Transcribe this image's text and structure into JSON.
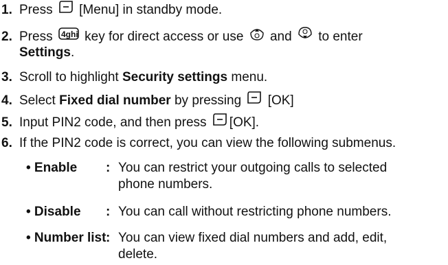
{
  "steps": [
    {
      "num": "1.",
      "pre": "Press",
      "post": "[Menu] in standby mode."
    },
    {
      "num": "2.",
      "pre": "Press",
      "mid1": "key for direct access or use",
      "mid2": "and",
      "mid3": "to enter",
      "bold2": "Settings",
      "end2": "."
    },
    {
      "num": "3.",
      "pre": "Scroll to highlight",
      "bold": "Security settings",
      "post": "menu."
    },
    {
      "num": "4.",
      "pre": "Select",
      "bold": "Fixed dial number",
      "mid": "by pressing",
      "post": "[OK]"
    },
    {
      "num": "5.",
      "pre": "Input PIN2 code, and then press",
      "post": "[OK]."
    },
    {
      "num": "6.",
      "pre": "If the PIN2 code is correct, you can view the following submenus."
    }
  ],
  "submenus": [
    {
      "term": "• Enable",
      "colon": ":",
      "desc1": "You can restrict your outgoing calls to selected",
      "desc2": "phone numbers."
    },
    {
      "term": "• Disable",
      "colon": ":",
      "desc1": "You can call without restricting phone numbers."
    },
    {
      "term": "• Number list",
      "colon": ":",
      "desc1": "You can view fixed dial numbers and add, edit,",
      "desc2": "delete."
    }
  ],
  "icons": {
    "softkey": "softkey-icon",
    "four_key": "four-ghi-key-icon",
    "nav_up": "navigation-up-key-icon",
    "nav_down": "navigation-down-key-icon",
    "four_key_label": "4ghi"
  }
}
